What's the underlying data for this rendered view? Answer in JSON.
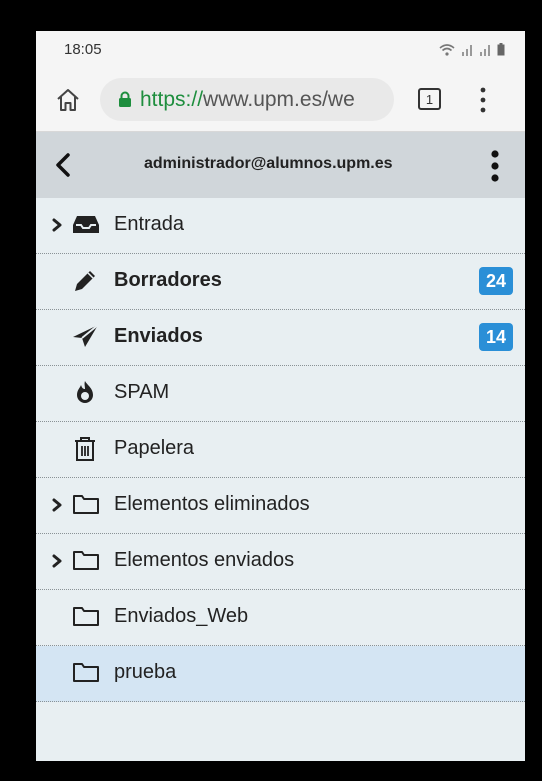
{
  "status_bar": {
    "time": "18:05"
  },
  "browser": {
    "url_scheme": "https://",
    "url_host": "www.upm.es/we",
    "tab_count": "1"
  },
  "mail_header": {
    "account": "administrador@alumnos.upm.es"
  },
  "folders": [
    {
      "label": "Entrada",
      "icon": "inbox-icon",
      "expandable": true,
      "bold": false,
      "badge": null
    },
    {
      "label": "Borradores",
      "icon": "pencil-icon",
      "expandable": false,
      "bold": true,
      "badge": "24"
    },
    {
      "label": "Enviados",
      "icon": "paper-plane-icon",
      "expandable": false,
      "bold": true,
      "badge": "14"
    },
    {
      "label": "SPAM",
      "icon": "fire-icon",
      "expandable": false,
      "bold": false,
      "badge": null
    },
    {
      "label": "Papelera",
      "icon": "trash-icon",
      "expandable": false,
      "bold": false,
      "badge": null
    },
    {
      "label": "Elementos eliminados",
      "icon": "folder-icon",
      "expandable": true,
      "bold": false,
      "badge": null
    },
    {
      "label": "Elementos enviados",
      "icon": "folder-icon",
      "expandable": true,
      "bold": false,
      "badge": null
    },
    {
      "label": "Enviados_Web",
      "icon": "folder-icon",
      "expandable": false,
      "bold": false,
      "badge": null
    },
    {
      "label": "prueba",
      "icon": "folder-icon",
      "expandable": false,
      "bold": false,
      "badge": null,
      "selected": true
    }
  ],
  "colors": {
    "badge": "#2a8fd7",
    "selected_row": "#d4e5f3",
    "header": "#d0d6da",
    "list_bg": "#e8eff2",
    "secure": "#1e8e3e"
  }
}
